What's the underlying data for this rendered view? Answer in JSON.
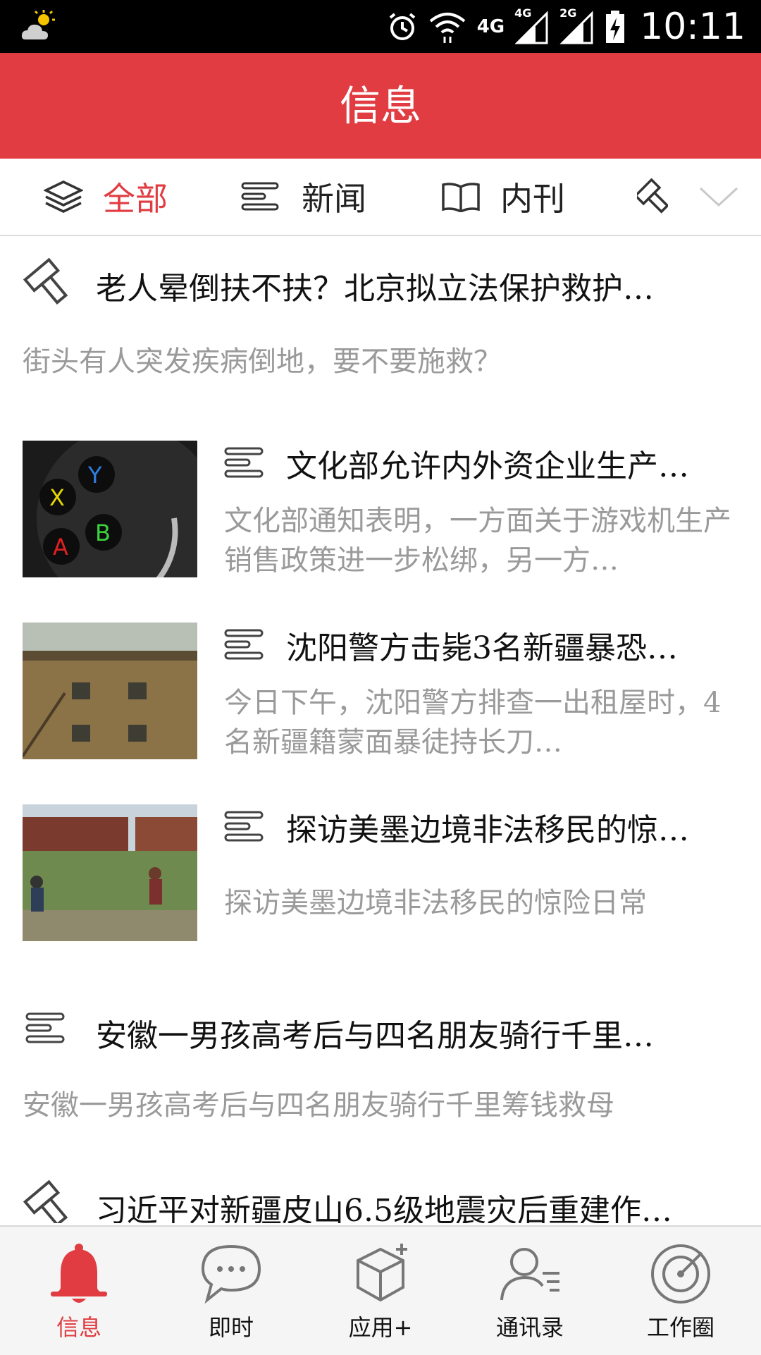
{
  "status_bar": {
    "time": "10:11",
    "network_labels": [
      "4G",
      "4G",
      "2G"
    ],
    "icons": [
      "weather-partly-cloudy-icon",
      "alarm-icon",
      "wifi-icon",
      "signal-icon",
      "signal-icon",
      "battery-charging-icon"
    ]
  },
  "header": {
    "title": "信息"
  },
  "tabs": {
    "items": [
      {
        "label": "全部",
        "icon": "layers-icon",
        "active": true
      },
      {
        "label": "新闻",
        "icon": "lines-icon",
        "active": false
      },
      {
        "label": "内刊",
        "icon": "book-icon",
        "active": false
      }
    ],
    "more_icon": "chevron-down-icon"
  },
  "feed": [
    {
      "type": "text",
      "icon": "gavel-icon",
      "title": "老人晕倒扶不扶？北京拟立法保护救护…",
      "summary": "街头有人突发疾病倒地，要不要施救？"
    },
    {
      "type": "image",
      "icon": "lines-icon",
      "thumb": "game-controller-buttons",
      "title": "文化部允许内外资企业生产…",
      "summary": "文化部通知表明，一方面关于游戏机生产销售政策进一步松绑，另一方…"
    },
    {
      "type": "image",
      "icon": "lines-icon",
      "thumb": "building",
      "title": "沈阳警方击毙3名新疆暴恐…",
      "summary": "今日下午，沈阳警方排查一出租屋时，4名新疆籍蒙面暴徒持长刀…"
    },
    {
      "type": "image",
      "icon": "lines-icon",
      "thumb": "border-train",
      "title": "探访美墨边境非法移民的惊…",
      "summary": "探访美墨边境非法移民的惊险日常"
    },
    {
      "type": "text",
      "icon": "lines-icon",
      "title": "安徽一男孩高考后与四名朋友骑行千里…",
      "summary": "安徽一男孩高考后与四名朋友骑行千里筹钱救母"
    },
    {
      "type": "text",
      "icon": "gavel-icon",
      "title": "习近平对新疆皮山6.5级地震灾后重建作…",
      "summary": ""
    }
  ],
  "bottom_nav": {
    "items": [
      {
        "label": "信息",
        "icon": "bell-icon",
        "active": true
      },
      {
        "label": "即时",
        "icon": "chat-bubble-icon",
        "active": false
      },
      {
        "label": "应用+",
        "icon": "box-plus-icon",
        "active": false
      },
      {
        "label": "通讯录",
        "icon": "contacts-icon",
        "active": false
      },
      {
        "label": "工作圈",
        "icon": "target-icon",
        "active": false
      }
    ]
  },
  "colors": {
    "accent": "#e03c41",
    "summary_gray": "#9a9a9a",
    "status_bar": "#000000"
  }
}
